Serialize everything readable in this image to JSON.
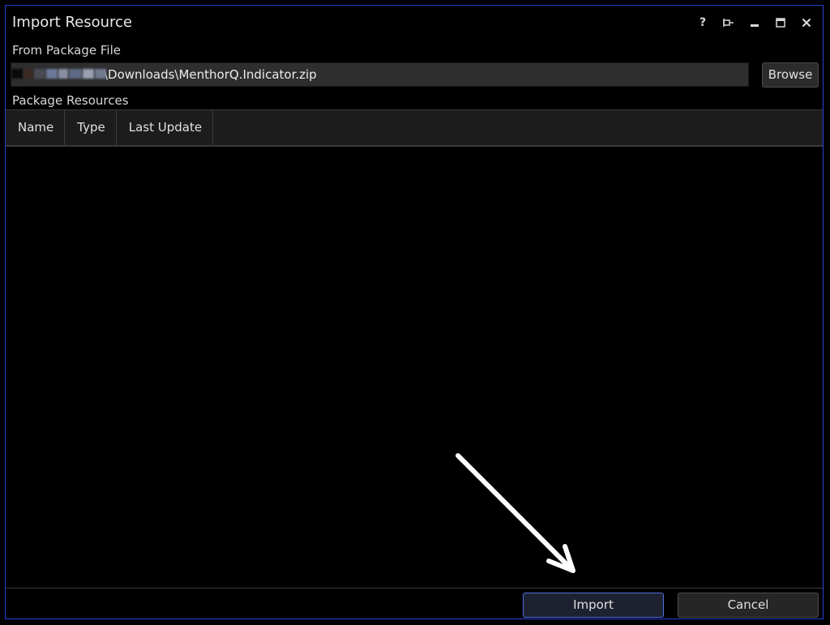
{
  "window": {
    "title": "Import Resource",
    "controls": [
      "help-icon",
      "pin-icon",
      "minimize-icon",
      "maximize-icon",
      "close-icon"
    ],
    "help_label": "?"
  },
  "source": {
    "label": "From Package File",
    "path_visible": "\\Downloads\\MenthorQ.Indicator.zip",
    "browse_label": "Browse"
  },
  "resources": {
    "label": "Package Resources",
    "columns": [
      "Name",
      "Type",
      "Last Update"
    ],
    "rows": []
  },
  "footer": {
    "import_label": "Import",
    "cancel_label": "Cancel"
  },
  "colors": {
    "window_border": "#2b3fd6",
    "background": "#000000",
    "primary_button_border": "#4f6de0"
  }
}
